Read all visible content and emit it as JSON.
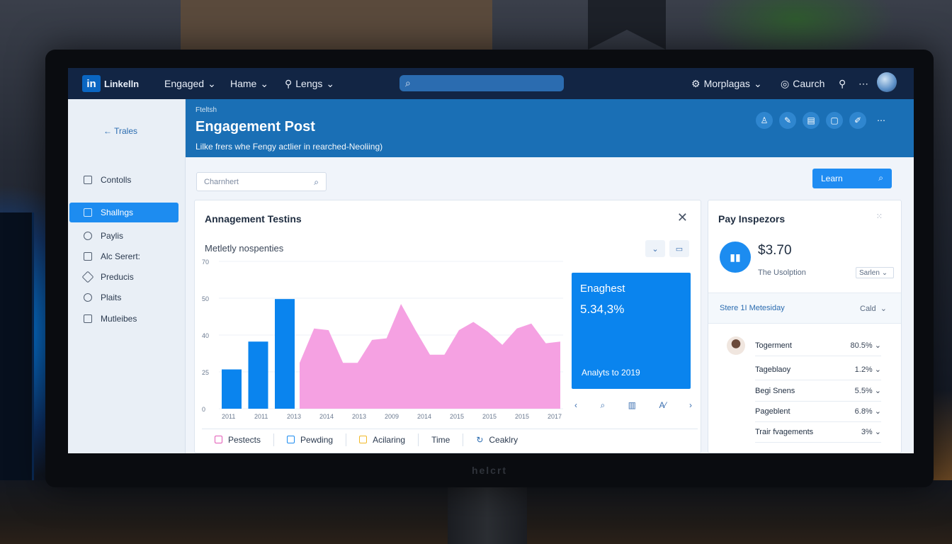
{
  "topbar": {
    "logo_text": "in",
    "brand": "Linkelln",
    "menu": [
      "Engaged",
      "Hame",
      "Lengs"
    ],
    "right": [
      "Morplagas",
      "Caurch"
    ]
  },
  "sidebar": {
    "back": "Trales",
    "items": [
      {
        "label": "Contolls",
        "active": false
      },
      {
        "label": "Shallngs",
        "active": true
      },
      {
        "label": "Paylis",
        "active": false
      },
      {
        "label": "Alc Serert:",
        "active": false
      },
      {
        "label": "Preducis",
        "active": false
      },
      {
        "label": "Plaits",
        "active": false
      },
      {
        "label": "Mutleibes",
        "active": false
      }
    ]
  },
  "header": {
    "crumb": "Fteltsh",
    "title": "Engagement Post",
    "subtitle": "Lilke frers whe Fengy actlier in rearched-Neoliing)"
  },
  "main": {
    "search_placeholder": "Charnhert",
    "learn_button": "Learn"
  },
  "card": {
    "title": "Annagement Testins",
    "subtitle": "Metletly nospenties",
    "stat_label": "Enaghest",
    "stat_value": "5.34,3%",
    "stat_footer": "Analyts to 2019",
    "legend": [
      "Pestects",
      "Pewding",
      "Acilaring",
      "Time",
      "Ceaklry"
    ]
  },
  "chart_data": {
    "type": "bar",
    "y_ticks": [
      "70",
      "50",
      "40",
      "25",
      "0"
    ],
    "x_labels": [
      "2011",
      "2011",
      "2013",
      "2014",
      "2013",
      "2009",
      "2014",
      "2015",
      "2015",
      "2015",
      "2017"
    ],
    "bars": {
      "categories": [
        "2011",
        "2011",
        "2013"
      ],
      "values": [
        24,
        41,
        67
      ],
      "color": "#0a84ee"
    },
    "area": {
      "values": [
        28,
        49,
        48,
        28,
        28,
        42,
        43,
        64,
        48,
        33,
        33,
        48,
        53,
        47,
        39,
        49,
        52,
        40,
        41
      ],
      "color": "#f49ce0"
    },
    "ylim": [
      0,
      90
    ]
  },
  "rpanel": {
    "title": "Pay Inspezors",
    "amount": "$3.70",
    "amount_label": "The Usolption",
    "select": "Sarlen",
    "filter_left": "Stere 1I Metesiday",
    "filter_right": "Cald",
    "rows": [
      {
        "label": "Togerment",
        "value": "80.5%"
      },
      {
        "label": "Tageblaoy",
        "value": "1.2%"
      },
      {
        "label": "Begi Snens",
        "value": "5.5%"
      },
      {
        "label": "Pageblent",
        "value": "6.8%"
      },
      {
        "label": "Trair fvagements",
        "value": "3%"
      }
    ]
  },
  "monitor_brand": "helcrt",
  "colors": {
    "accent": "#1d8cf0",
    "header": "#1a6fb5",
    "topbar": "#122544",
    "area": "#f49ce0"
  }
}
